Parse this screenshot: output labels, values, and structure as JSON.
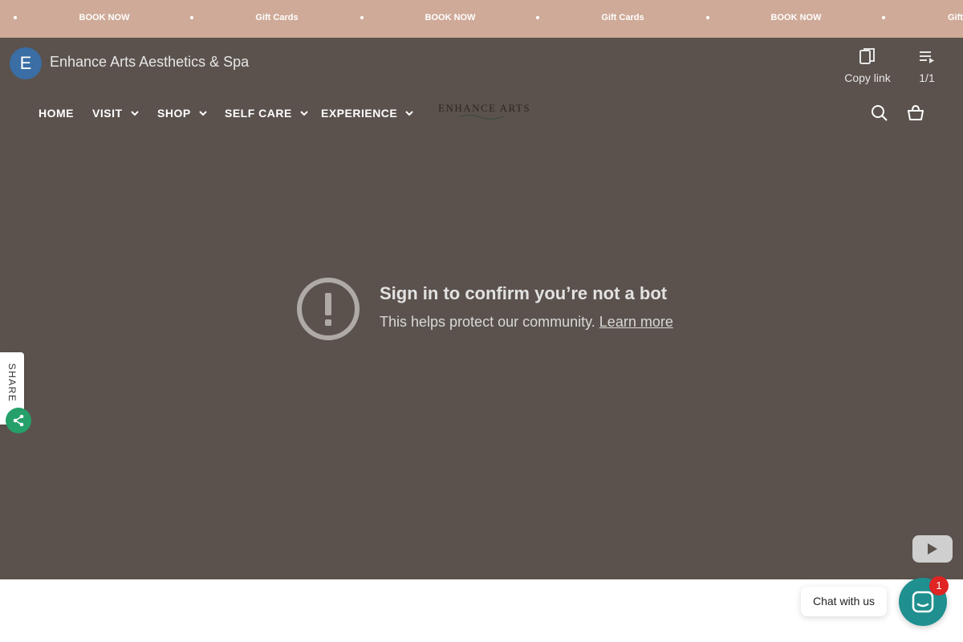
{
  "announcement": {
    "items": [
      "BOOK NOW",
      "Gift Cards",
      "BOOK NOW",
      "Gift Cards",
      "BOOK NOW",
      "Gift"
    ]
  },
  "video": {
    "channel_initial": "E",
    "title": "Enhance Arts Aesthetics & Spa",
    "copy_link_label": "Copy link",
    "playlist_count": "1/1",
    "error_title": "Sign in to confirm you’re not a bot",
    "error_message": "This helps protect our community.",
    "learn_more_label": "Learn more"
  },
  "nav": {
    "items": [
      {
        "label": "HOME",
        "has_dropdown": false
      },
      {
        "label": "VISIT",
        "has_dropdown": true
      },
      {
        "label": "SHOP",
        "has_dropdown": true
      },
      {
        "label": "SELF CARE",
        "has_dropdown": true
      },
      {
        "label": "EXPERIENCE",
        "has_dropdown": true
      }
    ],
    "logo_text": "ENHANCE ARTS",
    "icons": [
      "search-icon",
      "cart-icon"
    ]
  },
  "share": {
    "label": "SHARE"
  },
  "chat": {
    "label": "Chat with us",
    "badge_count": "1"
  },
  "colors": {
    "announcement_bg": "#cfaa98",
    "video_overlay_bg": "#5b524d",
    "share_button": "#25a06b",
    "chat_button": "#1f8f8f",
    "badge": "#e02424",
    "avatar": "#3a6ea5"
  }
}
